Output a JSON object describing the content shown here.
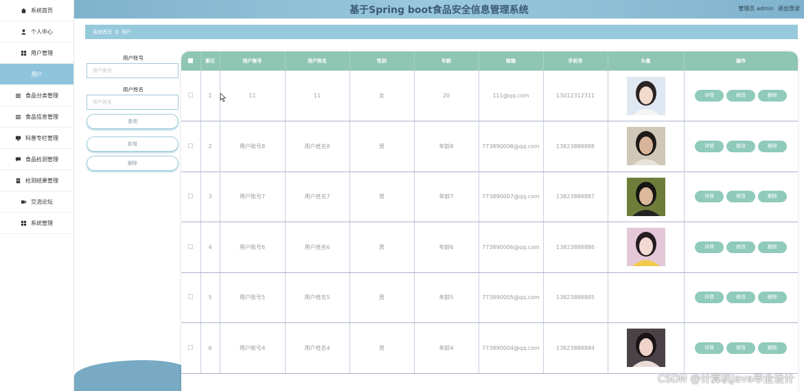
{
  "header": {
    "title": "基于Spring boot食品安全信息管理系统",
    "role_user": "管理员 admin",
    "logout": "退出登录"
  },
  "sidebar": {
    "items": [
      {
        "label": "系统首页",
        "icon": "home-icon"
      },
      {
        "label": "个人中心",
        "icon": "user-icon"
      },
      {
        "label": "用户管理",
        "icon": "grid-icon"
      },
      {
        "label": "用户",
        "icon": "",
        "active": true
      },
      {
        "label": "食品分类管理",
        "icon": "list-icon"
      },
      {
        "label": "食品信息管理",
        "icon": "list-icon"
      },
      {
        "label": "科普专栏管理",
        "icon": "monitor-icon"
      },
      {
        "label": "食品检测管理",
        "icon": "chat-icon"
      },
      {
        "label": "检测结果管理",
        "icon": "document-icon"
      },
      {
        "label": "交流论坛",
        "icon": "video-icon"
      },
      {
        "label": "系统管理",
        "icon": "grid-icon"
      }
    ]
  },
  "breadcrumb": {
    "home": "系统首页",
    "separator": "☰",
    "current": "用户"
  },
  "search": {
    "account_label": "用户账号",
    "account_placeholder": "用户账号",
    "name_label": "用户姓名",
    "name_placeholder": "用户姓名",
    "query_btn": "查询",
    "add_btn": "新增",
    "delete_btn": "删除"
  },
  "table": {
    "headers": [
      "索引",
      "用户账号",
      "用户姓名",
      "性别",
      "年龄",
      "邮箱",
      "手机号",
      "头像",
      "操作"
    ],
    "rows": [
      {
        "index": "1",
        "account": "11",
        "name": "11",
        "gender": "女",
        "age": "20",
        "email": "111@qq.com",
        "phone": "13012312311",
        "has_avatar": true
      },
      {
        "index": "2",
        "account": "用户账号8",
        "name": "用户姓名8",
        "gender": "男",
        "age": "年龄8",
        "email": "773890008@qq.com",
        "phone": "13823888888",
        "has_avatar": true
      },
      {
        "index": "3",
        "account": "用户账号7",
        "name": "用户姓名7",
        "gender": "男",
        "age": "年龄7",
        "email": "773890007@qq.com",
        "phone": "13823888887",
        "has_avatar": true
      },
      {
        "index": "4",
        "account": "用户账号6",
        "name": "用户姓名6",
        "gender": "男",
        "age": "年龄6",
        "email": "773890006@qq.com",
        "phone": "13823888886",
        "has_avatar": true
      },
      {
        "index": "5",
        "account": "用户账号5",
        "name": "用户姓名5",
        "gender": "男",
        "age": "年龄5",
        "email": "773890005@qq.com",
        "phone": "13823888885",
        "has_avatar": false
      },
      {
        "index": "6",
        "account": "用户账号4",
        "name": "用户姓名4",
        "gender": "男",
        "age": "年龄4",
        "email": "773890004@qq.com",
        "phone": "13823888884",
        "has_avatar": true
      }
    ],
    "actions": {
      "detail": "详情",
      "edit": "修改",
      "delete": "删除"
    }
  },
  "watermark": "CSDN @计算机Java毕业设计",
  "colors": {
    "header": "#8fc0d6",
    "table_header": "#8fc5b3",
    "action_button": "#8fcabb",
    "active_nav": "#8fc5dc"
  }
}
